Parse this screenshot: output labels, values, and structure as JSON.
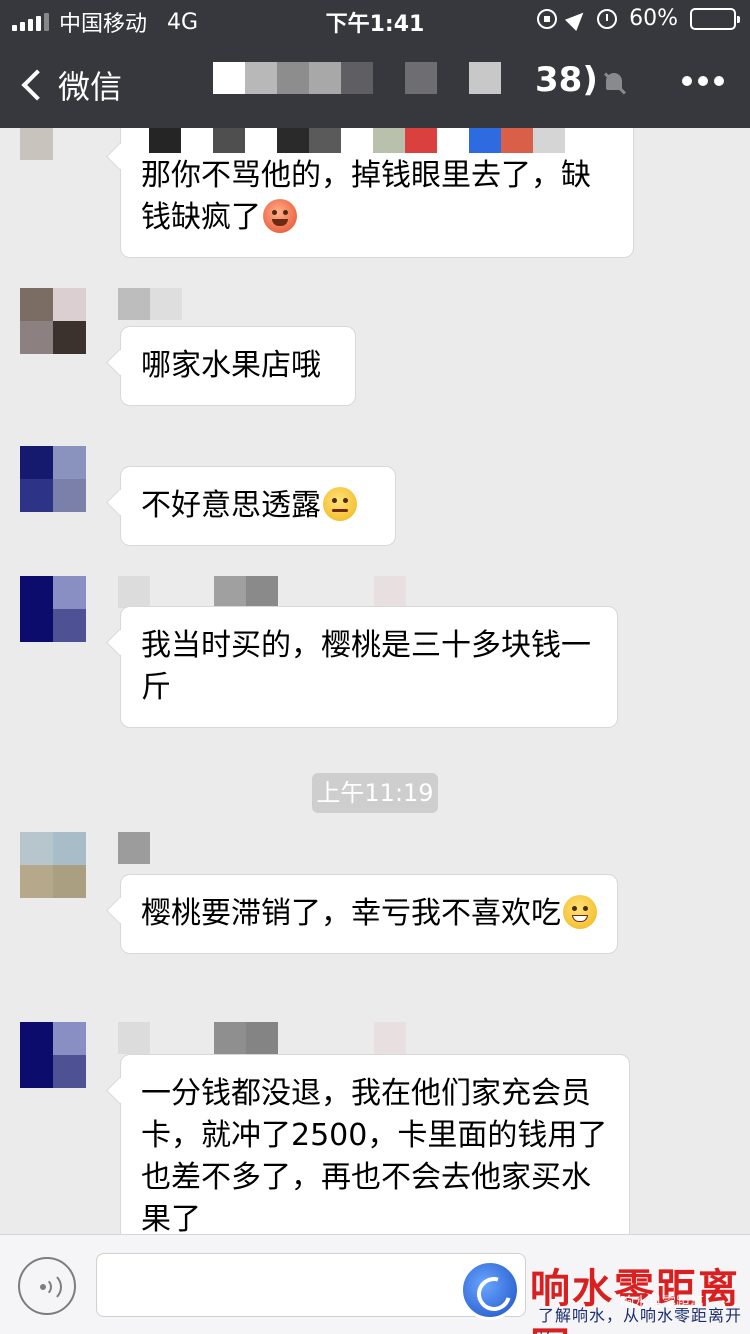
{
  "status_bar": {
    "carrier": "中国移动",
    "network": "4G",
    "time": "下午1:41",
    "battery_text": "60%",
    "battery_level": 0.6
  },
  "nav": {
    "back_label": "微信",
    "member_count": "38)"
  },
  "messages": [
    {
      "text": "那你不骂他的，掉钱眼里去了，缺钱缺疯了",
      "emoji": "angry-face-emoji"
    },
    {
      "text": "哪家水果店哦"
    },
    {
      "text": "不好意思透露",
      "emoji": "thinking-face-emoji"
    },
    {
      "text": "我当时买的，樱桃是三十多块钱一斤"
    },
    {
      "text": "樱桃要滞销了，幸亏我不喜欢吃",
      "emoji": "grinning-face-emoji"
    },
    {
      "text": "一分钱都没退，我在他们家充会员卡，就冲了2500，卡里面的钱用了也差不多了，再也不会去他家买水果了"
    }
  ],
  "timestamp": "上午11:19",
  "watermark": {
    "title": "响水零距离网",
    "subtitle": "了解响水，从响水零距离开始",
    "overlay": "响水县零距离"
  }
}
